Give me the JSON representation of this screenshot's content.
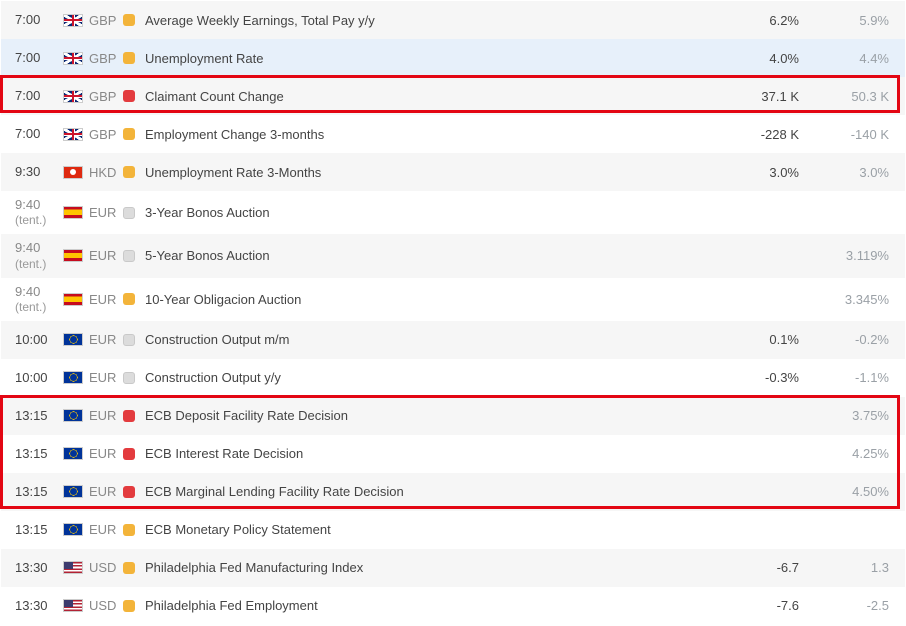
{
  "rows": [
    {
      "time": "7:00",
      "tent": "",
      "flag": "uk",
      "ccy": "GBP",
      "imp": "med",
      "event": "Average Weekly Earnings, Total Pay y/y",
      "v1": "6.2%",
      "v2": "5.9%"
    },
    {
      "time": "7:00",
      "tent": "",
      "flag": "uk",
      "ccy": "GBP",
      "imp": "med",
      "event": "Unemployment Rate",
      "v1": "4.0%",
      "v2": "4.4%"
    },
    {
      "time": "7:00",
      "tent": "",
      "flag": "uk",
      "ccy": "GBP",
      "imp": "high",
      "event": "Claimant Count Change",
      "v1": "37.1 K",
      "v2": "50.3 K"
    },
    {
      "time": "7:00",
      "tent": "",
      "flag": "uk",
      "ccy": "GBP",
      "imp": "med",
      "event": "Employment Change 3-months",
      "v1": "-228 K",
      "v2": "-140 K"
    },
    {
      "time": "9:30",
      "tent": "",
      "flag": "hk",
      "ccy": "HKD",
      "imp": "med",
      "event": "Unemployment Rate 3-Months",
      "v1": "3.0%",
      "v2": "3.0%"
    },
    {
      "time": "9:40",
      "tent": "(tent.)",
      "flag": "es",
      "ccy": "EUR",
      "imp": "low",
      "event": "3-Year Bonos Auction",
      "v1": "",
      "v2": ""
    },
    {
      "time": "9:40",
      "tent": "(tent.)",
      "flag": "es",
      "ccy": "EUR",
      "imp": "low",
      "event": "5-Year Bonos Auction",
      "v1": "",
      "v2": "3.119%"
    },
    {
      "time": "9:40",
      "tent": "(tent.)",
      "flag": "es",
      "ccy": "EUR",
      "imp": "med",
      "event": "10-Year Obligacion Auction",
      "v1": "",
      "v2": "3.345%"
    },
    {
      "time": "10:00",
      "tent": "",
      "flag": "eu",
      "ccy": "EUR",
      "imp": "low",
      "event": "Construction Output m/m",
      "v1": "0.1%",
      "v2": "-0.2%"
    },
    {
      "time": "10:00",
      "tent": "",
      "flag": "eu",
      "ccy": "EUR",
      "imp": "low",
      "event": "Construction Output y/y",
      "v1": "-0.3%",
      "v2": "-1.1%"
    },
    {
      "time": "13:15",
      "tent": "",
      "flag": "eu",
      "ccy": "EUR",
      "imp": "high",
      "event": "ECB Deposit Facility Rate Decision",
      "v1": "",
      "v2": "3.75%"
    },
    {
      "time": "13:15",
      "tent": "",
      "flag": "eu",
      "ccy": "EUR",
      "imp": "high",
      "event": "ECB Interest Rate Decision",
      "v1": "",
      "v2": "4.25%"
    },
    {
      "time": "13:15",
      "tent": "",
      "flag": "eu",
      "ccy": "EUR",
      "imp": "high",
      "event": "ECB Marginal Lending Facility Rate Decision",
      "v1": "",
      "v2": "4.50%"
    },
    {
      "time": "13:15",
      "tent": "",
      "flag": "eu",
      "ccy": "EUR",
      "imp": "med",
      "event": "ECB Monetary Policy Statement",
      "v1": "",
      "v2": ""
    },
    {
      "time": "13:30",
      "tent": "",
      "flag": "us",
      "ccy": "USD",
      "imp": "med",
      "event": "Philadelphia Fed Manufacturing Index",
      "v1": "-6.7",
      "v2": "1.3"
    },
    {
      "time": "13:30",
      "tent": "",
      "flag": "us",
      "ccy": "USD",
      "imp": "med",
      "event": "Philadelphia Fed Employment",
      "v1": "-7.6",
      "v2": "-2.5"
    }
  ],
  "highlight_boxes": [
    {
      "fromRow": 2,
      "toRow": 2
    },
    {
      "fromRow": 10,
      "toRow": 12
    }
  ],
  "highlighted_row_index": 1
}
